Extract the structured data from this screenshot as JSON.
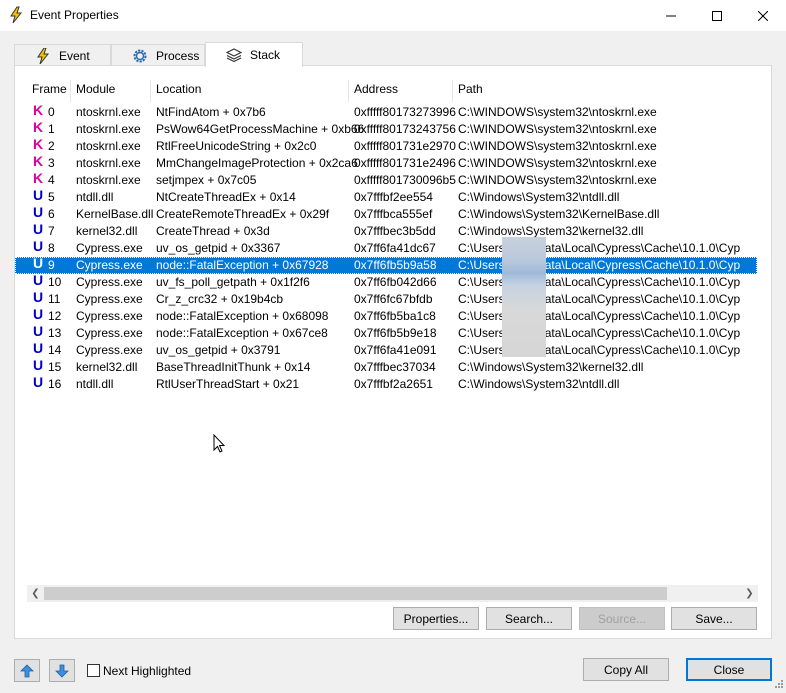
{
  "window": {
    "title": "Event Properties",
    "minimize_label": "",
    "maximize_label": "",
    "close_label": ""
  },
  "tabs": [
    {
      "label": "Event",
      "icon": "lightning-icon"
    },
    {
      "label": "Process",
      "icon": "gear-icon"
    },
    {
      "label": "Stack",
      "icon": "layers-icon",
      "active": true
    }
  ],
  "columns": [
    "Frame",
    "Module",
    "Location",
    "Address",
    "Path"
  ],
  "rows": [
    {
      "kind": "K",
      "frame": "0",
      "module": "ntoskrnl.exe",
      "location": "NtFindAtom + 0x7b6",
      "address": "0xfffff80173273996",
      "path": "C:\\WINDOWS\\system32\\ntoskrnl.exe"
    },
    {
      "kind": "K",
      "frame": "1",
      "module": "ntoskrnl.exe",
      "location": "PsWow64GetProcessMachine + 0xb66",
      "address": "0xfffff80173243756",
      "path": "C:\\WINDOWS\\system32\\ntoskrnl.exe"
    },
    {
      "kind": "K",
      "frame": "2",
      "module": "ntoskrnl.exe",
      "location": "RtlFreeUnicodeString + 0x2c0",
      "address": "0xfffff801731e2970",
      "path": "C:\\WINDOWS\\system32\\ntoskrnl.exe"
    },
    {
      "kind": "K",
      "frame": "3",
      "module": "ntoskrnl.exe",
      "location": "MmChangeImageProtection + 0x2ca6",
      "address": "0xfffff801731e2496",
      "path": "C:\\WINDOWS\\system32\\ntoskrnl.exe"
    },
    {
      "kind": "K",
      "frame": "4",
      "module": "ntoskrnl.exe",
      "location": "setjmpex + 0x7c05",
      "address": "0xfffff801730096b5",
      "path": "C:\\WINDOWS\\system32\\ntoskrnl.exe"
    },
    {
      "kind": "U",
      "frame": "5",
      "module": "ntdll.dll",
      "location": "NtCreateThreadEx + 0x14",
      "address": "0x7fffbf2ee554",
      "path": "C:\\Windows\\System32\\ntdll.dll"
    },
    {
      "kind": "U",
      "frame": "6",
      "module": "KernelBase.dll",
      "location": "CreateRemoteThreadEx + 0x29f",
      "address": "0x7fffbca555ef",
      "path": "C:\\Windows\\System32\\KernelBase.dll"
    },
    {
      "kind": "U",
      "frame": "7",
      "module": "kernel32.dll",
      "location": "CreateThread + 0x3d",
      "address": "0x7fffbec3b5dd",
      "path": "C:\\Windows\\System32\\kernel32.dll"
    },
    {
      "kind": "U",
      "frame": "8",
      "module": "Cypress.exe",
      "location": "uv_os_getpid + 0x3367",
      "address": "0x7ff6fa41dc67",
      "path": "C:\\Users\\          \\AppData\\Local\\Cypress\\Cache\\10.1.0\\Cyp"
    },
    {
      "kind": "U",
      "frame": "9",
      "module": "Cypress.exe",
      "location": "node::FatalException + 0x67928",
      "address": "0x7ff6fb5b9a58",
      "path": "C:\\Users\\          \\AppData\\Local\\Cypress\\Cache\\10.1.0\\Cyp",
      "selected": true
    },
    {
      "kind": "U",
      "frame": "10",
      "module": "Cypress.exe",
      "location": "uv_fs_poll_getpath + 0x1f2f6",
      "address": "0x7ff6fb042d66",
      "path": "C:\\Users\\          \\AppData\\Local\\Cypress\\Cache\\10.1.0\\Cyp"
    },
    {
      "kind": "U",
      "frame": "11",
      "module": "Cypress.exe",
      "location": "Cr_z_crc32 + 0x19b4cb",
      "address": "0x7ff6fc67bfdb",
      "path": "C:\\Users\\          \\AppData\\Local\\Cypress\\Cache\\10.1.0\\Cyp"
    },
    {
      "kind": "U",
      "frame": "12",
      "module": "Cypress.exe",
      "location": "node::FatalException + 0x68098",
      "address": "0x7ff6fb5ba1c8",
      "path": "C:\\Users\\          \\AppData\\Local\\Cypress\\Cache\\10.1.0\\Cyp"
    },
    {
      "kind": "U",
      "frame": "13",
      "module": "Cypress.exe",
      "location": "node::FatalException + 0x67ce8",
      "address": "0x7ff6fb5b9e18",
      "path": "C:\\Users\\          \\AppData\\Local\\Cypress\\Cache\\10.1.0\\Cyp"
    },
    {
      "kind": "U",
      "frame": "14",
      "module": "Cypress.exe",
      "location": "uv_os_getpid + 0x3791",
      "address": "0x7ff6fa41e091",
      "path": "C:\\Users\\          \\AppData\\Local\\Cypress\\Cache\\10.1.0\\Cyp"
    },
    {
      "kind": "U",
      "frame": "15",
      "module": "kernel32.dll",
      "location": "BaseThreadInitThunk + 0x14",
      "address": "0x7fffbec37034",
      "path": "C:\\Windows\\System32\\kernel32.dll"
    },
    {
      "kind": "U",
      "frame": "16",
      "module": "ntdll.dll",
      "location": "RtlUserThreadStart + 0x21",
      "address": "0x7fffbf2a2651",
      "path": "C:\\Windows\\System32\\ntdll.dll"
    }
  ],
  "buttons": {
    "properties": "Properties...",
    "search": "Search...",
    "source": "Source...",
    "save": "Save...",
    "copy_all": "Copy All",
    "close": "Close"
  },
  "next_highlighted_label": "Next Highlighted",
  "colors": {
    "kernel_marker": "#e000a0",
    "user_marker": "#0000c8",
    "selection": "#0078d7",
    "nav_arrow": "#3c8ede"
  }
}
